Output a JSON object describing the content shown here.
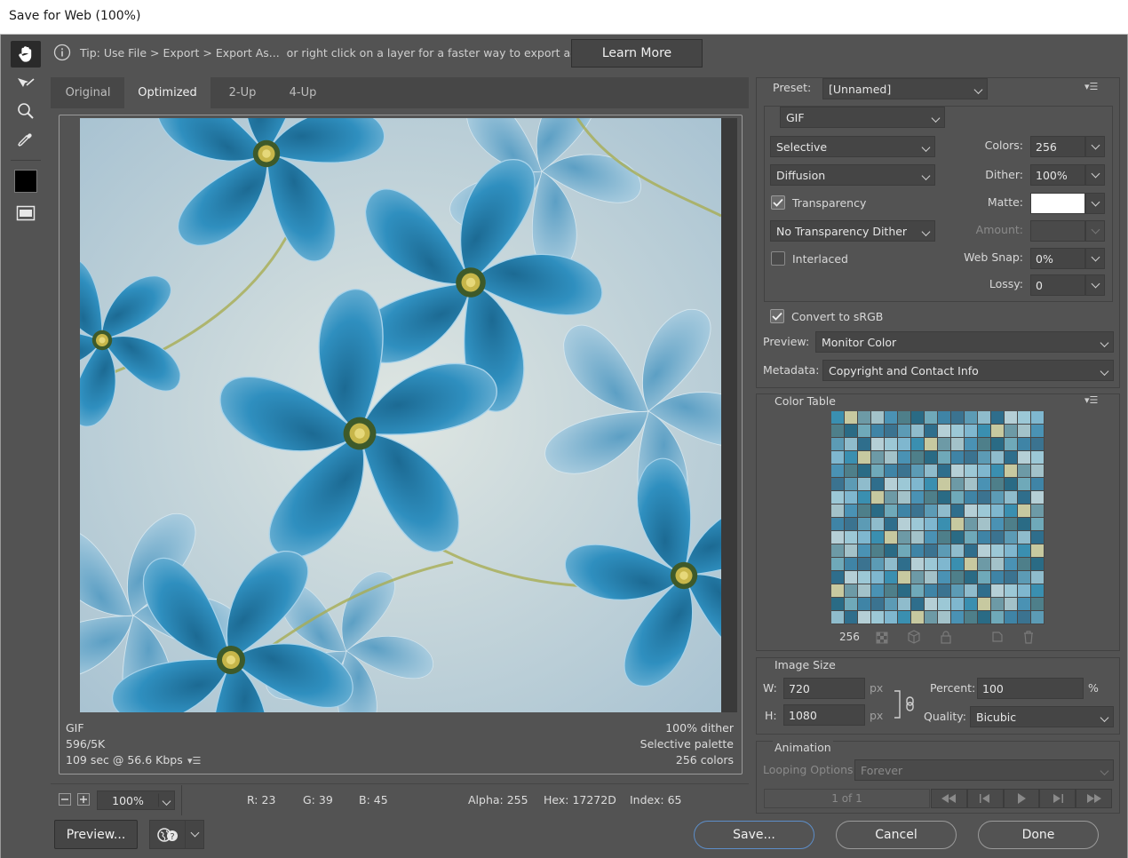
{
  "window": {
    "title": "Save for Web (100%)"
  },
  "tip": {
    "text": "Tip: Use File > Export > Export As...  or right click on a layer for a faster way to export assets",
    "learn_more": "Learn More"
  },
  "tools": [
    "hand-tool",
    "slice-select-tool",
    "zoom-tool",
    "eyedropper-tool",
    "eyedropper-color",
    "toggle-slices-visibility"
  ],
  "tabs": [
    {
      "label": "Original"
    },
    {
      "label": "Optimized"
    },
    {
      "label": "2-Up"
    },
    {
      "label": "4-Up"
    }
  ],
  "active_tab": "Optimized",
  "image_info": {
    "left": [
      "GIF",
      "596/5K",
      "109 sec @ 56.6 Kbps"
    ],
    "right": [
      "100% dither",
      "Selective palette",
      "256 colors"
    ]
  },
  "statusbar": {
    "zoom": "100%",
    "r": "R: 23",
    "g": "G: 39",
    "b": "B: 45",
    "alpha": "Alpha: 255",
    "hex": "Hex: 17272D",
    "index": "Index: 65"
  },
  "bottom": {
    "preview": "Preview...",
    "save": "Save...",
    "cancel": "Cancel",
    "done": "Done"
  },
  "settings": {
    "preset_label": "Preset:",
    "preset": "[Unnamed]",
    "format": "GIF",
    "reduction": "Selective",
    "dither_algo": "Diffusion",
    "transparency_label": "Transparency",
    "transparency": true,
    "trans_dither": "No Transparency Dither",
    "interlaced_label": "Interlaced",
    "interlaced": false,
    "colors_label": "Colors:",
    "colors": "256",
    "dither_label": "Dither:",
    "dither": "100%",
    "matte_label": "Matte:",
    "amount_label": "Amount:",
    "websnap_label": "Web Snap:",
    "websnap": "0%",
    "lossy_label": "Lossy:",
    "lossy": "0",
    "srgb_label": "Convert to sRGB",
    "srgb": true,
    "preview_label": "Preview:",
    "preview": "Monitor Color",
    "metadata_label": "Metadata:",
    "metadata": "Copyright and Contact Info"
  },
  "color_table": {
    "title": "Color Table",
    "count": "256",
    "colors": [
      "#3a8fb0",
      "#6fa9b9",
      "#9cc8d6",
      "#4e7f8a",
      "#2f6e8c",
      "#a3c2c9",
      "#5c9bb5",
      "#c7c9a0",
      "#3f84a6",
      "#7fb7cf",
      "#2a6b85",
      "#b5cfd6",
      "#4a92b4",
      "#8fbccc",
      "#6d9aa6",
      "#3b7390"
    ]
  },
  "image_size": {
    "title": "Image Size",
    "w_label": "W:",
    "w": "720",
    "h_label": "H:",
    "h": "1080",
    "unit": "px",
    "percent_label": "Percent:",
    "percent": "100",
    "percent_unit": "%",
    "quality_label": "Quality:",
    "quality": "Bicubic"
  },
  "animation": {
    "title": "Animation",
    "looping_label": "Looping Options:",
    "looping": "Forever",
    "frame": "1 of 1"
  }
}
